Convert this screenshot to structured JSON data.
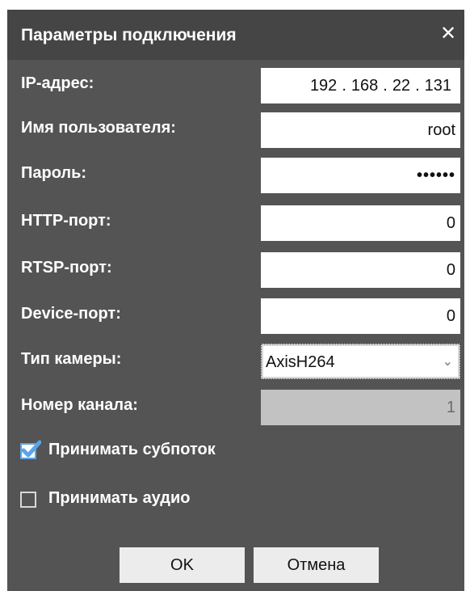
{
  "dialog": {
    "title": "Параметры подключения",
    "close_glyph": "✕"
  },
  "fields": {
    "ip": {
      "label": "IP-адрес:",
      "octets": [
        "192",
        "168",
        "22",
        "131"
      ],
      "separator": "."
    },
    "username": {
      "label": "Имя пользователя:",
      "value": "root"
    },
    "password": {
      "label": "Пароль:",
      "value": "••••••"
    },
    "http_port": {
      "label": "HTTP-порт:",
      "value": "0"
    },
    "rtsp_port": {
      "label": "RTSP-порт:",
      "value": "0"
    },
    "device_port": {
      "label": "Device-порт:",
      "value": "0"
    },
    "camera_type": {
      "label": "Тип камеры:",
      "value": "AxisH264",
      "chevron_icon": "chevron-down-icon"
    },
    "channel": {
      "label": "Номер канала:",
      "value": "1"
    }
  },
  "checkboxes": {
    "substream": {
      "label": "Принимать субпоток",
      "checked": true
    },
    "audio": {
      "label": "Принимать аудио",
      "checked": false
    }
  },
  "buttons": {
    "ok": "OK",
    "cancel": "Отмена"
  },
  "colors": {
    "dialog_bg": "#545454",
    "titlebar_bg": "#454545",
    "check_accent": "#5da4e6"
  }
}
